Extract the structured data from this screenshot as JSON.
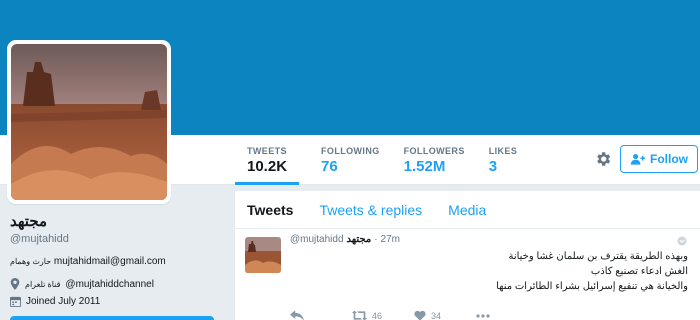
{
  "colors": {
    "banner": "#0b84bf",
    "accent": "#1da1f2",
    "text": "#14171a",
    "muted": "#657786"
  },
  "profile": {
    "display_name": "مجتهد",
    "handle": "@mujtahidd",
    "bio_email": "mujtahidmail@gmail.com",
    "bio_arabic": "حارث وهمام",
    "telegram_label": "قناة تلغرام",
    "telegram_handle": "@mujtahiddchannel",
    "joined": "Joined July 2011",
    "location_icon": "location-pin-icon",
    "calendar_icon": "calendar-icon"
  },
  "stats": [
    {
      "label": "TWEETS",
      "value": "10.2K"
    },
    {
      "label": "FOLLOWING",
      "value": "76"
    },
    {
      "label": "FOLLOWERS",
      "value": "1.52M"
    },
    {
      "label": "LIKES",
      "value": "3"
    }
  ],
  "actions": {
    "settings_icon": "gear-icon",
    "follow_label": "Follow"
  },
  "tabs": [
    {
      "label": "Tweets"
    },
    {
      "label": "Tweets & replies"
    },
    {
      "label": "Media"
    }
  ],
  "tweet": {
    "name": "مجتهد",
    "handle": "@mujtahidd",
    "separator": "·",
    "time": "27m",
    "lines": [
      "وبهذه الطريقة يقترف بن سلمان غشا وخيانة",
      "الغش ادعاء تصنيع كاذب",
      "والخيانة هي تنفيع إسرائيل بشراء الطائرات منها"
    ],
    "retweets": "46",
    "likes": "34"
  }
}
